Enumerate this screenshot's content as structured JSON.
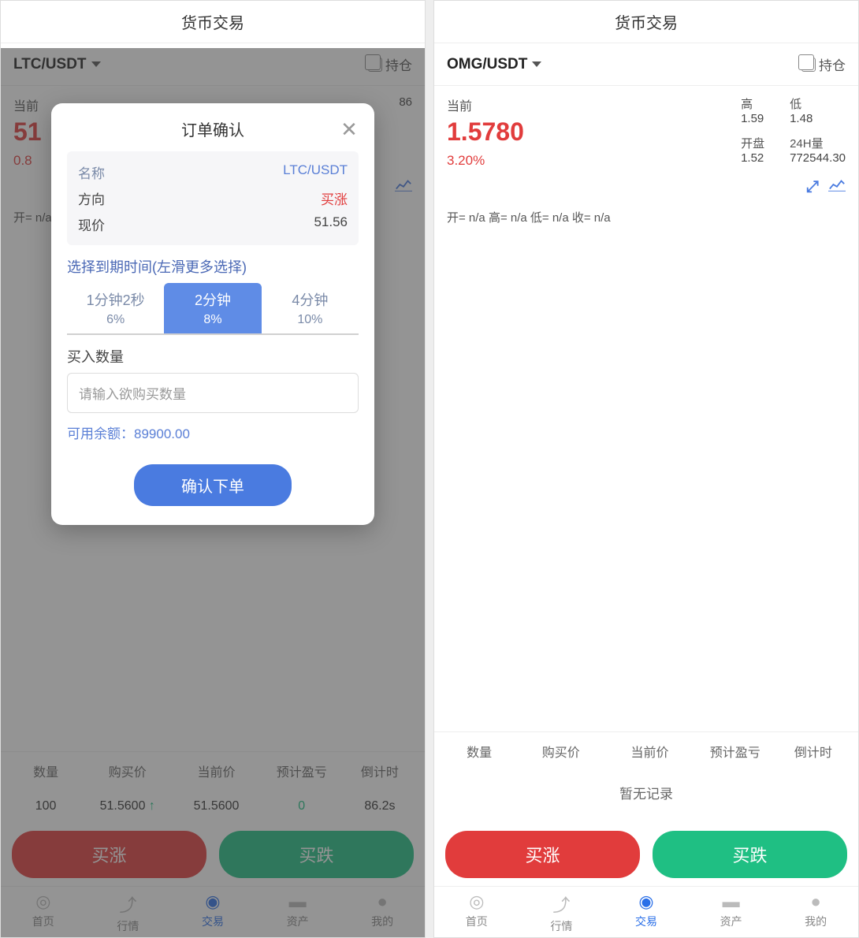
{
  "left": {
    "header": "货币交易",
    "pair": "LTC/USDT",
    "positions_label": "持仓",
    "current_label": "当前",
    "price": "51",
    "pct": "0.8",
    "ohlc": "开= n/a",
    "table_head": {
      "qty": "数量",
      "buy": "购买价",
      "cur": "当前价",
      "pnl": "预计盈亏",
      "cd": "倒计时"
    },
    "row": {
      "qty": "100",
      "buy": "51.5600",
      "arrow": "↑",
      "cur": "51.5600",
      "pnl": "0",
      "cd": "86.2s"
    },
    "buy_up": "买涨",
    "buy_down": "买跌",
    "modal": {
      "title": "订单确认",
      "lines": [
        {
          "label": "名称",
          "val": "LTC/USDT",
          "label_cls": "info-label",
          "val_cls": "info-val blue"
        },
        {
          "label": "方向",
          "val": "买涨",
          "label_cls": "info-label dark",
          "val_cls": "info-val red"
        },
        {
          "label": "现价",
          "val": "51.56",
          "label_cls": "info-label dark",
          "val_cls": "info-val"
        }
      ],
      "select_label": "选择到期时间(左滑更多选择)",
      "times": [
        {
          "t": "1分钟2秒",
          "p": "6%",
          "active": false
        },
        {
          "t": "2分钟",
          "p": "8%",
          "active": true
        },
        {
          "t": "4分钟",
          "p": "10%",
          "active": false
        }
      ],
      "qty_label": "买入数量",
      "qty_placeholder": "请输入欲购买数量",
      "balance_label": "可用余额：",
      "balance_value": "89900.00",
      "confirm": "确认下单"
    }
  },
  "right": {
    "header": "货币交易",
    "pair": "OMG/USDT",
    "positions_label": "持仓",
    "current_label": "当前",
    "price": "1.5780",
    "pct": "3.20%",
    "stats": {
      "high_label": "高",
      "high": "1.59",
      "low_label": "低",
      "low": "1.48",
      "open_label": "开盘",
      "open": "1.52",
      "vol_label": "24H量",
      "vol": "772544.30"
    },
    "ohlc": "开= n/a  高= n/a  低= n/a  收= n/a",
    "table_head": {
      "qty": "数量",
      "buy": "购买价",
      "cur": "当前价",
      "pnl": "预计盈亏",
      "cd": "倒计时"
    },
    "no_record": "暂无记录",
    "buy_up": "买涨",
    "buy_down": "买跌"
  },
  "tabs": [
    {
      "icon": "◎",
      "label": "首页",
      "name": "home"
    },
    {
      "icon": "⤴",
      "label": "行情",
      "name": "market"
    },
    {
      "icon": "◉",
      "label": "交易",
      "name": "trade"
    },
    {
      "icon": "▬",
      "label": "资产",
      "name": "assets"
    },
    {
      "icon": "●",
      "label": "我的",
      "name": "mine"
    }
  ],
  "mid_86": "86"
}
